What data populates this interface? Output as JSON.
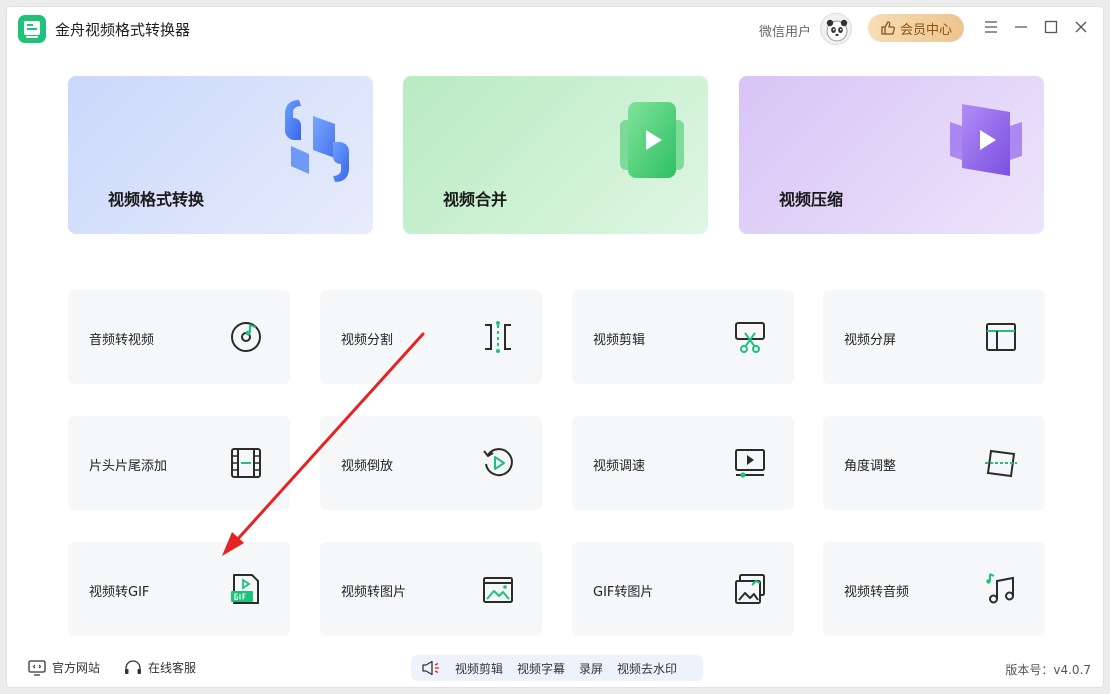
{
  "app": {
    "title": "金舟视频格式转换器"
  },
  "header": {
    "user_name": "微信用户",
    "vip_label": "会员中心"
  },
  "hero_cards": [
    {
      "label": "视频格式转换"
    },
    {
      "label": "视频合并"
    },
    {
      "label": "视频压缩"
    }
  ],
  "tools": [
    {
      "label": "音频转视频"
    },
    {
      "label": "视频分割"
    },
    {
      "label": "视频剪辑"
    },
    {
      "label": "视频分屏"
    },
    {
      "label": "片头片尾添加"
    },
    {
      "label": "视频倒放"
    },
    {
      "label": "视频调速"
    },
    {
      "label": "角度调整"
    },
    {
      "label": "视频转GIF"
    },
    {
      "label": "视频转图片"
    },
    {
      "label": "GIF转图片"
    },
    {
      "label": "视频转音频"
    }
  ],
  "footer": {
    "website": "官方网站",
    "service": "在线客服",
    "links": [
      "视频剪辑",
      "视频字幕",
      "录屏",
      "视频去水印"
    ],
    "version": "版本号：v4.0.7"
  },
  "colors": {
    "accent_green": "#1ec27a",
    "icon_dark": "#2b2b2b",
    "arrow_red": "#e52323",
    "vip_text": "#8a5215"
  }
}
